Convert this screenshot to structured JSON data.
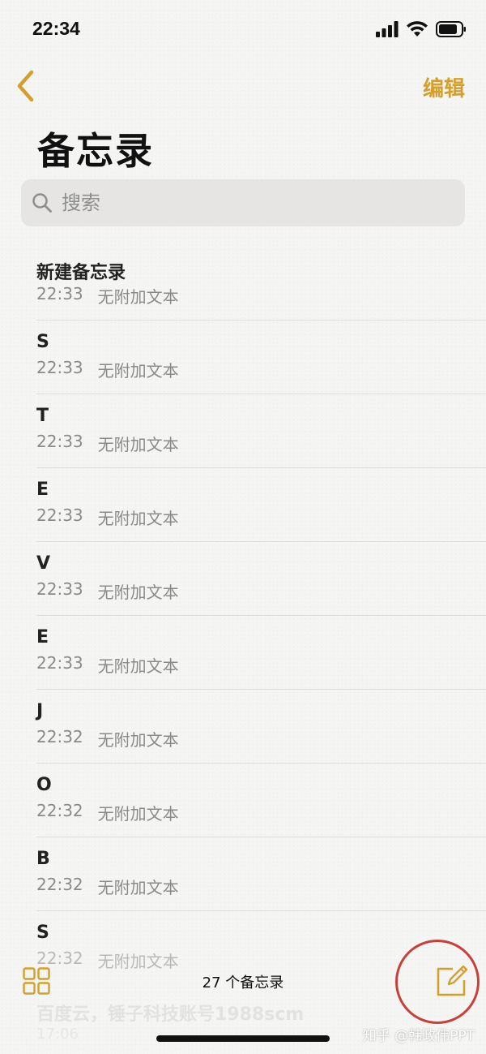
{
  "status_bar": {
    "time": "22:34"
  },
  "nav": {
    "edit_label": "编辑"
  },
  "title": "备忘录",
  "search": {
    "placeholder": "搜索"
  },
  "notes": [
    {
      "title": "新建备忘录",
      "time": "22:33",
      "preview": "无附加文本"
    },
    {
      "title": "S",
      "time": "22:33",
      "preview": "无附加文本"
    },
    {
      "title": "T",
      "time": "22:33",
      "preview": "无附加文本"
    },
    {
      "title": "E",
      "time": "22:33",
      "preview": "无附加文本"
    },
    {
      "title": "V",
      "time": "22:33",
      "preview": "无附加文本"
    },
    {
      "title": "E",
      "time": "22:33",
      "preview": "无附加文本"
    },
    {
      "title": "J",
      "time": "22:32",
      "preview": "无附加文本"
    },
    {
      "title": "O",
      "time": "22:32",
      "preview": "无附加文本"
    },
    {
      "title": "B",
      "time": "22:32",
      "preview": "无附加文本"
    },
    {
      "title": "S",
      "time": "22:32",
      "preview": "无附加文本"
    }
  ],
  "ghost_note": {
    "title": "百度云，锤子科技账号1988scm",
    "meta": "17:06"
  },
  "toolbar": {
    "count_label": "27 个备忘录"
  },
  "watermark": "知乎 @韩政伟PPT",
  "colors": {
    "accent": "#d4a02d",
    "highlight_circle": "#c9403a"
  },
  "icons": {
    "back": "chevron-left-icon",
    "search": "search-icon",
    "gallery": "grid-icon",
    "compose": "compose-icon"
  }
}
